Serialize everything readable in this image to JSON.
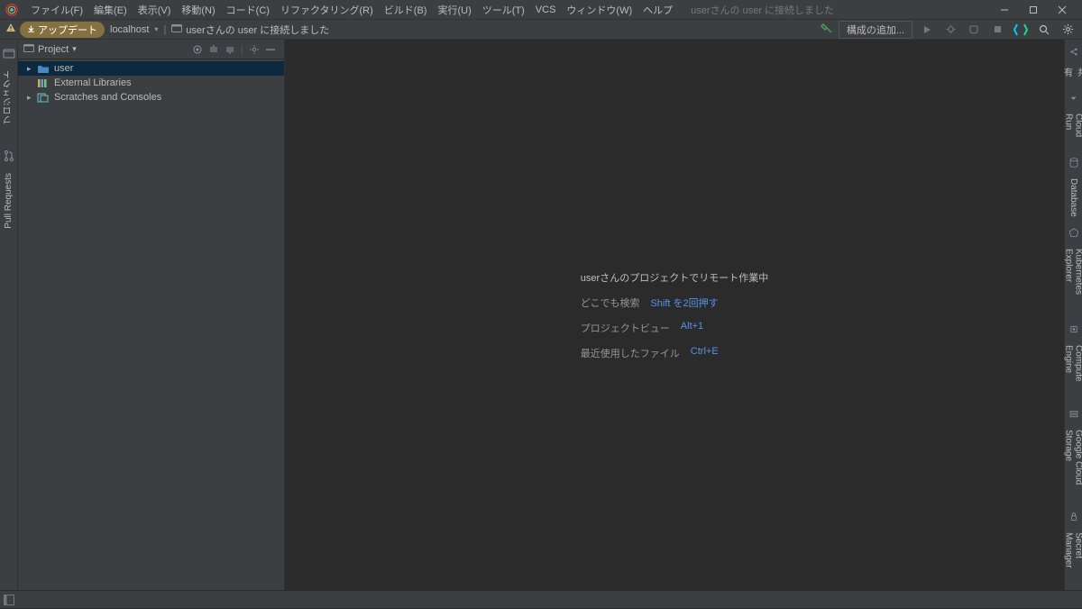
{
  "menu": {
    "items": [
      "ファイル(F)",
      "編集(E)",
      "表示(V)",
      "移動(N)",
      "コード(C)",
      "リファクタリング(R)",
      "ビルド(B)",
      "実行(U)",
      "ツール(T)",
      "VCS",
      "ウィンドウ(W)",
      "ヘルプ"
    ],
    "title_suffix": "userさんの user に接続しました"
  },
  "breadcrumb": {
    "update_label": "アップデート",
    "host": "localhost",
    "path": "userさんの user に接続しました",
    "run_config": "構成の追加..."
  },
  "left_gutter": {
    "tabs": [
      {
        "icon": "folder",
        "label": "プロジェクト"
      },
      {
        "icon": "pull",
        "label": "Pull Requests"
      },
      {
        "icon": "structure",
        "label": ""
      }
    ]
  },
  "project_panel": {
    "title": "Project",
    "tree": [
      {
        "icon": "folder-blue",
        "label": "user",
        "selected": true,
        "arrow": true
      },
      {
        "icon": "library",
        "label": "External Libraries",
        "arrow": false
      },
      {
        "icon": "scratch",
        "label": "Scratches and Consoles",
        "arrow": true
      }
    ]
  },
  "welcome": {
    "title": "userさんのプロジェクトでリモート作業中",
    "rows": [
      {
        "label": "どこでも検索",
        "shortcut": "Shift を2回押す"
      },
      {
        "label": "プロジェクトビュー",
        "shortcut": "Alt+1"
      },
      {
        "label": "最近使用したファイル",
        "shortcut": "Ctrl+E"
      }
    ]
  },
  "right_gutter": {
    "tabs": [
      {
        "label": "共有"
      },
      {
        "label": "Cloud Run"
      },
      {
        "label": "Database"
      },
      {
        "label": "Kubernetes Explorer"
      },
      {
        "label": "Compute Engine"
      },
      {
        "label": "Google Cloud Storage"
      },
      {
        "label": "Secret Manager"
      }
    ]
  }
}
